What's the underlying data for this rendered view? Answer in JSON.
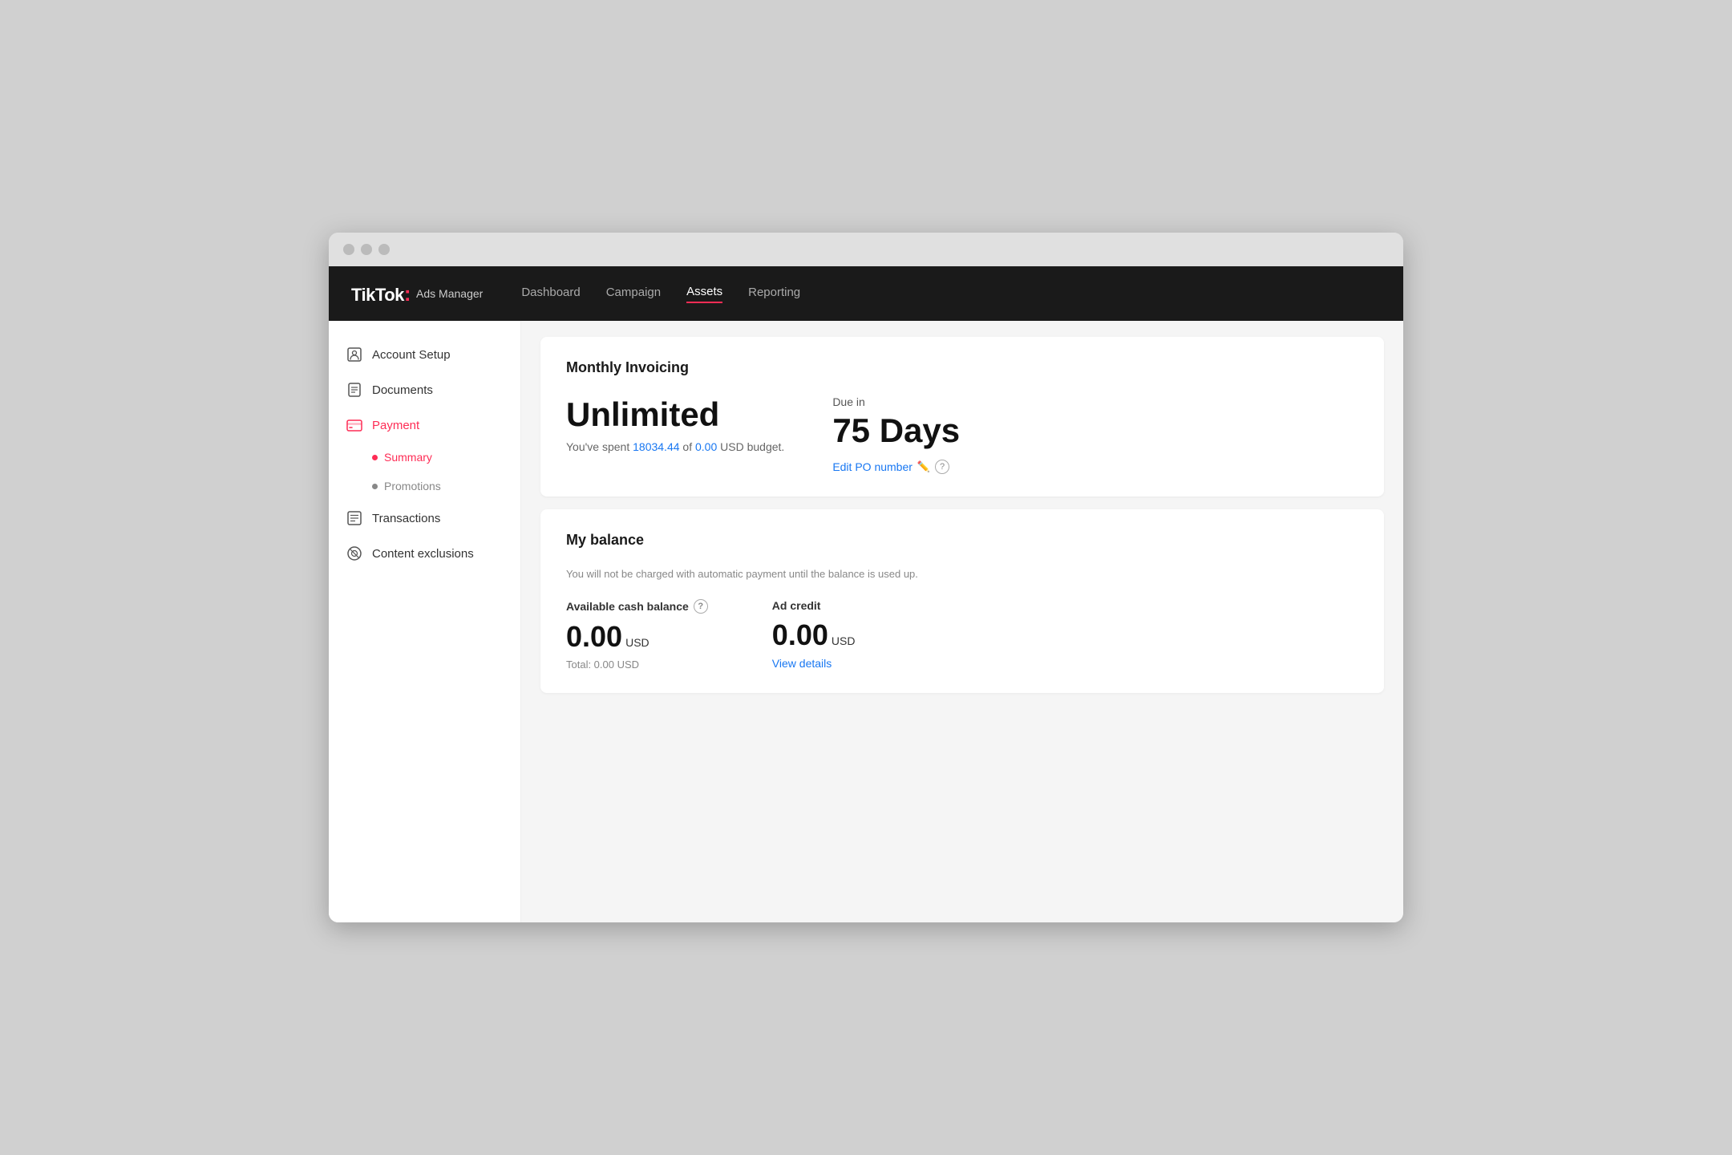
{
  "browser": {
    "traffic_lights": [
      "close",
      "minimize",
      "maximize"
    ]
  },
  "topnav": {
    "brand": "TikTok",
    "brand_colon": ":",
    "brand_sub": "Ads Manager",
    "links": [
      {
        "label": "Dashboard",
        "active": false
      },
      {
        "label": "Campaign",
        "active": false
      },
      {
        "label": "Assets",
        "active": true
      },
      {
        "label": "Reporting",
        "active": false
      }
    ]
  },
  "sidebar": {
    "items": [
      {
        "label": "Account Setup",
        "icon": "account-setup-icon",
        "active": false
      },
      {
        "label": "Documents",
        "icon": "documents-icon",
        "active": false
      },
      {
        "label": "Payment",
        "icon": "payment-icon",
        "active": true,
        "subitems": [
          {
            "label": "Summary",
            "active": true
          },
          {
            "label": "Promotions",
            "active": false
          }
        ]
      },
      {
        "label": "Transactions",
        "icon": "transactions-icon",
        "active": false
      },
      {
        "label": "Content exclusions",
        "icon": "content-exclusions-icon",
        "active": false
      }
    ]
  },
  "monthly_invoicing": {
    "title": "Monthly Invoicing",
    "budget_label": "Unlimited",
    "spent_prefix": "You've spent ",
    "spent_amount": "18034.44",
    "spent_of": " of ",
    "spent_of_amount": "0.00",
    "spent_suffix": " USD budget.",
    "due_label": "Due in",
    "days_value": "75 Days",
    "edit_po_label": "Edit PO number"
  },
  "my_balance": {
    "title": "My balance",
    "subtitle": "You will not be charged with automatic payment until the balance is used up.",
    "cash_balance_label": "Available cash balance",
    "cash_balance_amount": "0.00",
    "cash_balance_currency": "USD",
    "cash_balance_total": "Total: 0.00 USD",
    "ad_credit_label": "Ad credit",
    "ad_credit_amount": "0.00",
    "ad_credit_currency": "USD",
    "view_details_label": "View details"
  }
}
